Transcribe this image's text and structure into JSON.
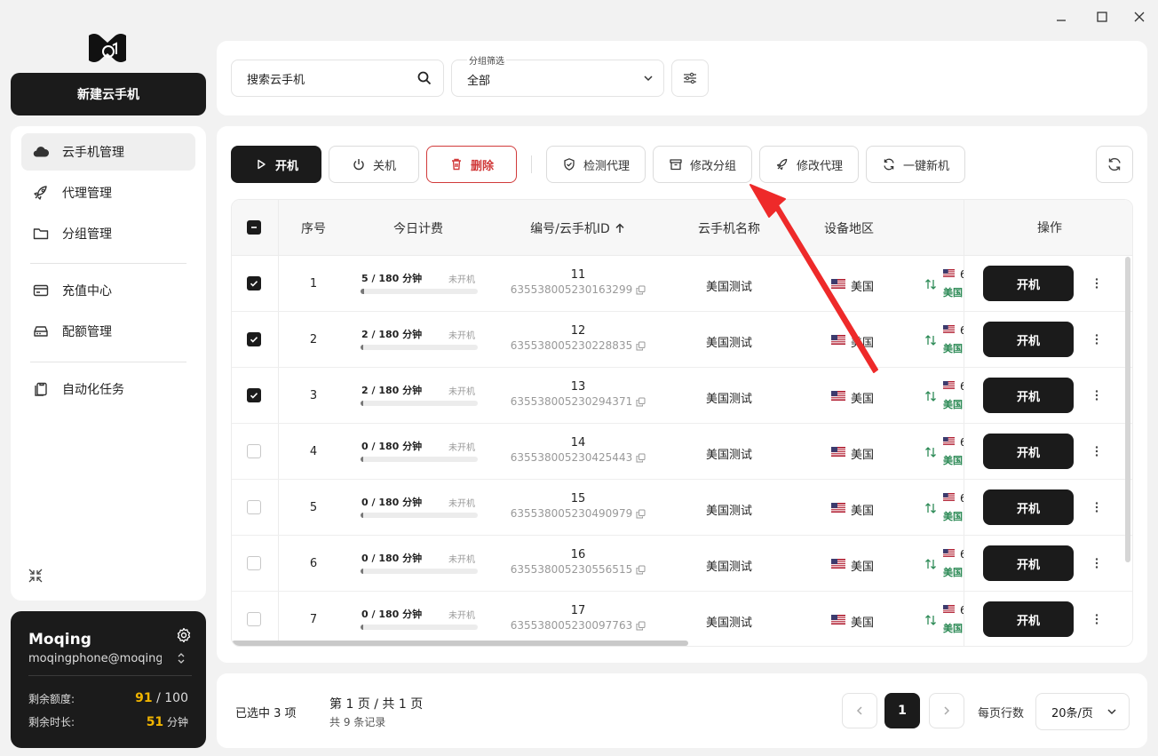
{
  "sidebar": {
    "new_button": "新建云手机",
    "items": [
      {
        "label": "云手机管理",
        "icon": "cloud-icon",
        "active": true
      },
      {
        "label": "代理管理",
        "icon": "rocket-icon"
      },
      {
        "label": "分组管理",
        "icon": "folder-icon"
      },
      {
        "label": "充值中心",
        "icon": "card-icon"
      },
      {
        "label": "配额管理",
        "icon": "storage-icon"
      },
      {
        "label": "自动化任务",
        "icon": "clipboard-icon"
      }
    ]
  },
  "user": {
    "name": "Moqing",
    "email": "moqingphone@moqing....",
    "quota_label": "剩余额度:",
    "quota_used": "91",
    "quota_total": " / 100",
    "time_label": "剩余时长:",
    "time_value": "51",
    "time_unit": " 分钟"
  },
  "filter": {
    "search_placeholder": "搜索云手机",
    "group_label": "分组筛选",
    "group_value": "全部"
  },
  "toolbar": {
    "start": "开机",
    "stop": "关机",
    "delete": "删除",
    "check_proxy": "检测代理",
    "edit_group": "修改分组",
    "edit_proxy": "修改代理",
    "new_device": "一键新机"
  },
  "table": {
    "headers": {
      "index": "序号",
      "billing": "今日计费",
      "id": "编号/云手机ID",
      "name": "云手机名称",
      "region": "设备地区",
      "ops": "操作"
    },
    "rows": [
      {
        "index": "1",
        "usage": "5 / 180 分钟",
        "usage_ratio": 0.028,
        "status": "未开机",
        "num": "11",
        "pid": "635538005230163299",
        "name": "美国测试",
        "region": "美国",
        "proxy_region": "美国",
        "proxy_num": "6",
        "checked": true,
        "op": "开机"
      },
      {
        "index": "2",
        "usage": "2 / 180 分钟",
        "usage_ratio": 0.011,
        "status": "未开机",
        "num": "12",
        "pid": "635538005230228835",
        "name": "美国测试",
        "region": "美国",
        "proxy_region": "美国",
        "proxy_num": "6",
        "checked": true,
        "op": "开机"
      },
      {
        "index": "3",
        "usage": "2 / 180 分钟",
        "usage_ratio": 0.011,
        "status": "未开机",
        "num": "13",
        "pid": "635538005230294371",
        "name": "美国测试",
        "region": "美国",
        "proxy_region": "美国",
        "proxy_num": "6",
        "checked": true,
        "op": "开机"
      },
      {
        "index": "4",
        "usage": "0 / 180 分钟",
        "usage_ratio": 0,
        "status": "未开机",
        "num": "14",
        "pid": "635538005230425443",
        "name": "美国测试",
        "region": "美国",
        "proxy_region": "美国",
        "proxy_num": "6",
        "checked": false,
        "op": "开机"
      },
      {
        "index": "5",
        "usage": "0 / 180 分钟",
        "usage_ratio": 0,
        "status": "未开机",
        "num": "15",
        "pid": "635538005230490979",
        "name": "美国测试",
        "region": "美国",
        "proxy_region": "美国",
        "proxy_num": "6",
        "checked": false,
        "op": "开机"
      },
      {
        "index": "6",
        "usage": "0 / 180 分钟",
        "usage_ratio": 0,
        "status": "未开机",
        "num": "16",
        "pid": "635538005230556515",
        "name": "美国测试",
        "region": "美国",
        "proxy_region": "美国",
        "proxy_num": "6",
        "checked": false,
        "op": "开机"
      },
      {
        "index": "7",
        "usage": "0 / 180 分钟",
        "usage_ratio": 0,
        "status": "未开机",
        "num": "17",
        "pid": "635538005230097763",
        "name": "美国测试",
        "region": "美国",
        "proxy_region": "美国",
        "proxy_num": "6",
        "checked": false,
        "op": "开机"
      }
    ]
  },
  "footer": {
    "selected": "已选中 3 项",
    "page_info": "第 1 页 / 共 1 页",
    "total": "共 9 条记录",
    "current_page": "1",
    "rows_label": "每页行数",
    "rows_value": "20条/页"
  },
  "colors": {
    "dark": "#1b1b1b",
    "danger": "#d13a3a",
    "accent": "#f0b400",
    "proxy_green": "#2e8b57",
    "annotation": "#ee2a2a"
  }
}
